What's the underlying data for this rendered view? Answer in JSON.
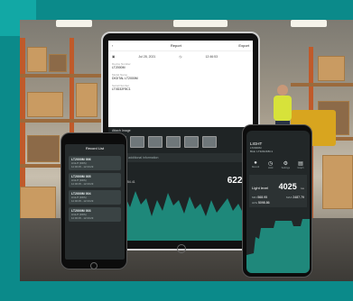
{
  "colors": {
    "frame": "#0b8a8a",
    "accent": "#12a8a5",
    "chart_fill": "#1f9a8a"
  },
  "tablet": {
    "title": "Report",
    "action": "Export",
    "date": "Jul 28, 2021",
    "time": "12:46:53",
    "fields": [
      {
        "label": "Device Number",
        "value": "LT2000M"
      },
      {
        "label": "Model Name",
        "value": "DIGITAL LT2000M"
      },
      {
        "label": "Serial Number",
        "value": "LT0D32F8C1"
      }
    ],
    "attach_label": "Attach Image",
    "attach_action": "Edit",
    "note_placeholder": "Enter the additional information",
    "stat_label": "Max",
    "stat_value": "6054.41",
    "big_value": "6229"
  },
  "left_phone": {
    "title": "Record List",
    "records": [
      {
        "id": "LT2000M 006",
        "lines": [
          "LIGHT (DDS)",
          "12:00:05 - 12:00:29"
        ]
      },
      {
        "id": "LT2000M 005",
        "lines": [
          "LIGHT (DDS)",
          "12:00:05 - 12:00:29"
        ]
      },
      {
        "id": "LT2000M 004",
        "lines": [
          "LIGHT (DDS)",
          "12:00:05 - 12:00:29"
        ]
      },
      {
        "id": "LT2000M 003",
        "lines": [
          "LIGHT (DDS)",
          "12:00:05 - 12:00:29"
        ]
      }
    ]
  },
  "right_phone": {
    "device_name": "LIGHT",
    "device_model": "LT2000M",
    "device_sub": "BLE: LT32D2F8C1",
    "icons": [
      {
        "name": "record-icon",
        "glyph": "●",
        "label": "Record"
      },
      {
        "name": "clock-icon",
        "glyph": "◷",
        "label": "Hold"
      },
      {
        "name": "settings-icon",
        "glyph": "⚙",
        "label": "Settings"
      },
      {
        "name": "chart-icon",
        "glyph": "▤",
        "label": "Graph"
      }
    ],
    "level_label": "Light level",
    "level_value": "4025",
    "level_unit": "lux",
    "min_label": "MIN",
    "min_value": "568.95",
    "max_label": "MAX",
    "max_value": "2487.79",
    "avg_label": "AVG",
    "avg_value": "5098.86"
  }
}
